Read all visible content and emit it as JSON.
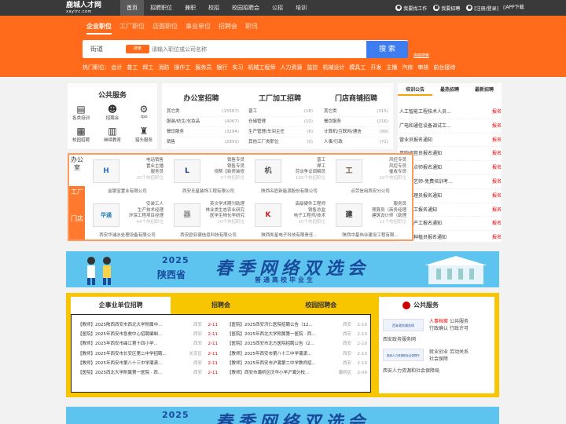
{
  "logo": {
    "name": "鹿城人才网",
    "sub": "xaytrc.com"
  },
  "topnav": [
    "首页",
    "招聘职位",
    "兼职",
    "校招",
    "校园招聘会",
    "公招",
    "培训"
  ],
  "topright": {
    "find_job": "我要找工作",
    "hire": "我要招聘",
    "login": "[注册/登录]",
    "app": "APP下载"
  },
  "subtabs": [
    "企业职位",
    "工厂职位",
    "店面职位",
    "事业单位",
    "招聘会",
    "职讯"
  ],
  "search": {
    "street_label": "街道",
    "street_badge": "搜索",
    "placeholder": "请输入职位或公司名称",
    "button": "搜 索",
    "advanced": "高级搜索"
  },
  "hotjobs": {
    "label": "热门职位:",
    "items": [
      "会计",
      "普工",
      "焊工",
      "消防",
      "操作工",
      "服务员",
      "银行",
      "实习",
      "机械工程师",
      "人力资源",
      "监控",
      "机械设计",
      "模具工",
      "开发",
      "主播",
      "汽修",
      "审核",
      "前台接待"
    ]
  },
  "public_service": {
    "title": "公共服务",
    "items": [
      {
        "icon": "book-icon",
        "label": "各类培训"
      },
      {
        "icon": "people-icon",
        "label": "招聘会"
      },
      {
        "icon": "rpo-icon",
        "label": "rpo"
      },
      {
        "icon": "building-icon",
        "label": "校园招聘"
      },
      {
        "icon": "books-icon",
        "label": "继续教育"
      },
      {
        "icon": "badge-icon",
        "label": "猎头服务"
      }
    ]
  },
  "office": {
    "title": "办公室招聘",
    "rows": [
      [
        "其它类",
        "(15507)"
      ],
      [
        "服装/纺生/化妆品",
        "(4067)"
      ],
      [
        "餐饮服务",
        "(3294)"
      ],
      [
        "销售",
        "(2891)"
      ]
    ]
  },
  "factory": {
    "title": "工厂加工招聘",
    "rows": [
      [
        "普工",
        "(18)"
      ],
      [
        "仓储管理",
        "(10)"
      ],
      [
        "生产管理/车间主任",
        "(6)"
      ],
      [
        "其他工厂类职位",
        "(0)"
      ]
    ]
  },
  "store": {
    "title": "门店商铺招聘",
    "rows": [
      [
        "其它类",
        "(315)"
      ],
      [
        "餐饮服务",
        "(216)"
      ],
      [
        "计算机/互联网/通信",
        "(99)"
      ],
      [
        "人事/行政",
        "(72)"
      ]
    ]
  },
  "training": {
    "tabs": [
      "培训公告",
      "最热招聘",
      "最新招聘"
    ],
    "items": [
      [
        "人工智能工程技术人员...",
        "报名"
      ],
      [
        "广电和通信设备调试工...",
        "报名"
      ],
      [
        "营业员报名通知",
        "报名"
      ],
      [
        "音响调音员报名通知",
        "报名"
      ],
      [
        "西式面点师报名通知",
        "报名"
      ],
      [
        "中级茶艺师-免费培训考...",
        "报名"
      ],
      [
        "公墓管理员报名通知",
        "报名"
      ],
      [
        "机修钳工报名通知",
        "报名"
      ],
      [
        "硝酸生产工报名通知",
        "报名"
      ],
      [
        "中药材种植员报名通知",
        "报名"
      ]
    ]
  },
  "featured": {
    "tabs": [
      "办公室",
      "工厂",
      "门店"
    ],
    "companies": [
      {
        "logo": "H",
        "jobs": [
          "电话销售",
          "置业主播",
          "服务员"
        ],
        "count": "20个热招职位",
        "name": "金银宝置业有限公司"
      },
      {
        "logo": "L",
        "jobs": [
          "销售专员",
          "销售专员",
          "视帮【新房装修"
        ],
        "count": "3个热招职位",
        "name": "西安氏星装饰工程有限公司"
      },
      {
        "logo": "机",
        "jobs": [
          "普工",
          "焊工",
          "劳动争议调解员"
        ],
        "count": "160个热招职位",
        "name": "陕西名匠新能源股份有限公司"
      },
      {
        "logo": "工",
        "jobs": [
          "风控专员",
          "风控专员",
          "催收专员"
        ],
        "count": "10个热招职位",
        "name": "点劳信用西安分公司"
      },
      {
        "logo": "华通",
        "jobs": [
          "安装工人",
          "生产技术经理",
          "环保工程项目经理"
        ],
        "count": "44个热招职位",
        "name": "西安华浦水处理设备有限公司"
      },
      {
        "logo": "器",
        "jobs": [
          "英文学术期刊助理",
          "林业类生态农业研究",
          "医学生物化学研究"
        ],
        "count": "20个热招职位",
        "name": "西安欧亚德信息科技有限公司"
      },
      {
        "logo": "K",
        "jobs": [
          "高级硬件工程师",
          "销售总监",
          "电子工程师/技术"
        ],
        "count": "20个热招职位",
        "name": "陕西凯星电子科技有限责任..."
      },
      {
        "logo": "建",
        "jobs": [
          "服务员",
          "预算员（商务经理",
          "建筑设计师（助理"
        ],
        "count": "11个热招职位",
        "name": "陕西中基伟业建设工程有限..."
      }
    ]
  },
  "banner": {
    "year": "2025",
    "province": "陕西省",
    "headline": "春季网络双选会",
    "subline": "普通高校毕业生"
  },
  "jobs": {
    "tabs": [
      "企事业单位招聘",
      "招聘会",
      "校园招聘会"
    ],
    "left": [
      [
        "【教师】2025陕西西安市西北大学附属中...",
        "西安",
        "2-11"
      ],
      [
        "【医院】2025年西安市急救中心招聘编制...",
        "西安",
        "2-11"
      ],
      [
        "【教师】2025年西安市曲江第十四小学...",
        "西安",
        "2-11"
      ],
      [
        "【教师】2025年西安市长安区第二中学招聘...",
        "长安区",
        "2-11"
      ],
      [
        "【教师】2025年西安市第八十三中学灞潇...",
        "西安",
        "2-11"
      ],
      [
        "【医院】2025西北大学附属第一医院 · 西...",
        "西安",
        "2-11"
      ]
    ],
    "right": [
      [
        "【医院】2025西安济仁医院招聘公告（12...",
        "西安",
        "2-10"
      ],
      [
        "【医院】2025年西北大学附属第一医院 · 西...",
        "西安",
        "2-10"
      ],
      [
        "【医院】2025西安市北方医院招聘公告（2...",
        "西安",
        "2-10"
      ],
      [
        "【教师】2025年西安市第八十三中学灞潇...",
        "西安",
        "2-10"
      ],
      [
        "【教师】2025年西安市沪灞第二中学教师招...",
        "西安",
        "2-10"
      ],
      [
        "【教师】西安市灞桥区庆华小学浐灞分校...",
        "灞桥区",
        "2-09"
      ]
    ]
  },
  "pubsvc": {
    "title": "公共服务",
    "blocks": [
      {
        "img": "西安政务服务网",
        "lines": [
          "人事档案",
          "公共服务",
          "行政确认",
          "行政许可"
        ],
        "caption": "西安政务服务网"
      },
      {
        "img": "陕西人力资源和社会保障厅",
        "lines": [
          "就业创业",
          "劳动关系",
          "社会保障"
        ],
        "caption": "西安人力资源和社会保障局"
      }
    ]
  }
}
